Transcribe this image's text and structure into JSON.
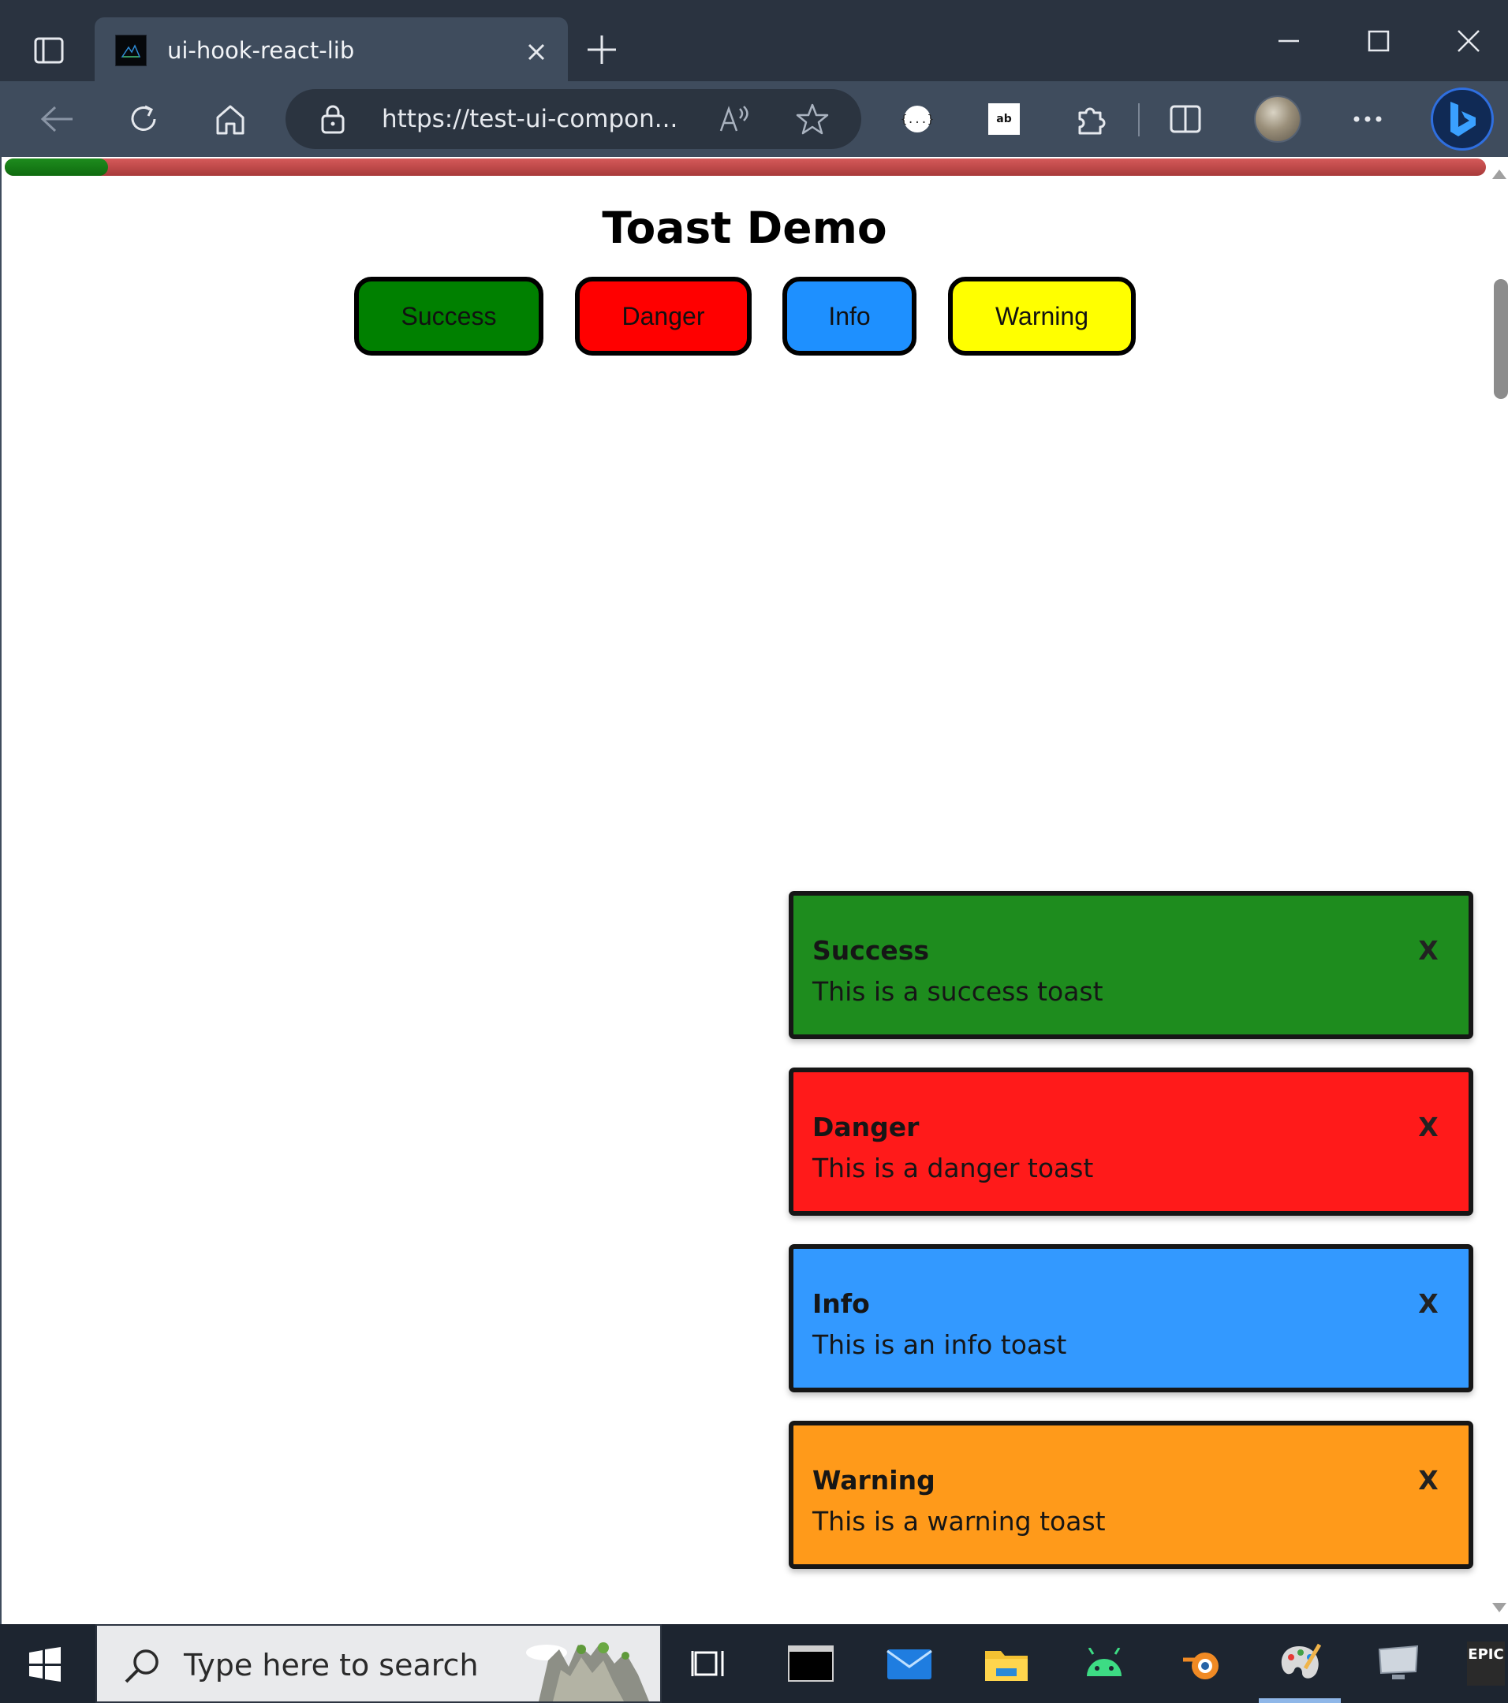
{
  "browser": {
    "tab": {
      "title": "ui-hook-react-lib"
    },
    "address": {
      "url": "https://test-ui-compon..."
    },
    "extensions": {
      "adblock_label": "ab"
    }
  },
  "page": {
    "progress": {
      "value_fraction": 0.07,
      "fill_color": "#0f7a0f",
      "track_color": "#c04848"
    },
    "title": "Toast Demo",
    "buttons": [
      {
        "label": "Success",
        "color": "#008000"
      },
      {
        "label": "Danger",
        "color": "#ff0000"
      },
      {
        "label": "Info",
        "color": "#1e90ff"
      },
      {
        "label": "Warning",
        "color": "#ffff00"
      }
    ],
    "toasts": [
      {
        "title": "Success",
        "message": "This is a success toast",
        "close_label": "X",
        "color": "#1e8c1e"
      },
      {
        "title": "Danger",
        "message": "This is a danger toast",
        "close_label": "X",
        "color": "#ff1a1a"
      },
      {
        "title": "Info",
        "message": "This is an info toast",
        "close_label": "X",
        "color": "#3399ff"
      },
      {
        "title": "Warning",
        "message": "This is a warning toast",
        "close_label": "X",
        "color": "#ff9a1a"
      }
    ]
  },
  "taskbar": {
    "search": {
      "placeholder": "Type here to search"
    },
    "epic_label": "EPIC"
  }
}
